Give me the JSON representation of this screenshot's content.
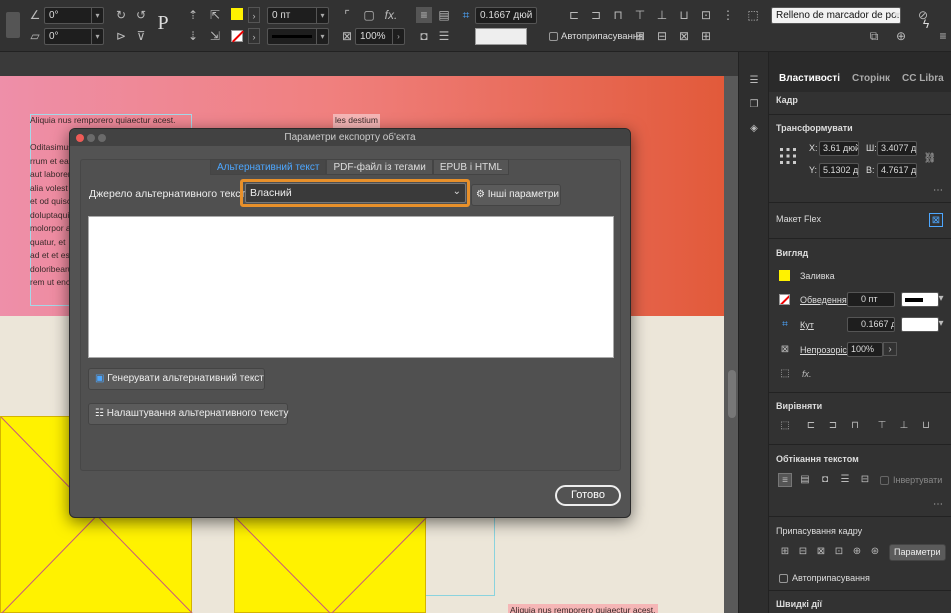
{
  "topbar": {
    "angle1": "0°",
    "angle2": "0°",
    "stroke_weight": "0 пт",
    "zoom": "100%",
    "corner_size": "0.1667 дюй",
    "auto_fit_label": "Автоприпасування",
    "style_select": "Relleno de marcador de po...",
    "fx": "fx.",
    "p_glyph": "P"
  },
  "document": {
    "text_lines": [
      "Aliquia nus remporero quiaectur acest.",
      "",
      "Oditasimus",
      "rrum et ea",
      "aut laborer",
      "alia volest",
      "et od quisc",
      "doluptaqui",
      "molorpor a",
      "quatur, et",
      "ad et et est",
      "doloribearu",
      "rem ut enc"
    ],
    "caption": "les destium",
    "bottom_caption": "Aliquia nus remporero quiaectur acest."
  },
  "dialog": {
    "title": "Параметри експорту об'єкта",
    "tabs": [
      {
        "label": "Альтернативний текст",
        "active": true
      },
      {
        "label": "PDF-файл із тегами",
        "active": false
      },
      {
        "label": "EPUB і HTML",
        "active": false
      }
    ],
    "source_label": "Джерело альтернативного тексту:",
    "source_value": "Власний",
    "more_options": "Інші параметри",
    "alt_text_value": "",
    "generate_button": "Генерувати альтернативний текст",
    "settings_button": "Налаштування альтернативного тексту",
    "done_button": "Готово"
  },
  "panel": {
    "tabs": [
      {
        "label": "Властивості",
        "active": true
      },
      {
        "label": "Сторінк",
        "active": false
      },
      {
        "label": "CC Libra",
        "active": false
      }
    ],
    "frame": "Кадр",
    "transform": "Трансформувати",
    "x_label": "X:",
    "x_value": "3.61 дюй",
    "y_label": "Y:",
    "y_value": "5.1302 дн",
    "w_label": "Ш:",
    "w_value": "3.4077 ді",
    "h_label": "В:",
    "h_value": "4.7617 ді",
    "flex_layout": "Макет Flex",
    "appearance": "Вигляд",
    "fill": "Заливка",
    "stroke": "Обведення",
    "stroke_value": "0 пт",
    "corner": "Кут",
    "corner_value": "0.1667 д",
    "opacity": "Непрозорість",
    "opacity_value": "100%",
    "fx": "fx.",
    "align": "Вирівняти",
    "text_wrap": "Обтікання текстом",
    "invert": "Інвертувати",
    "frame_fitting": "Припасування кадру",
    "fitting_params": "Параметри",
    "auto_fit": "Автоприпасування",
    "quick_actions": "Швидкі дії"
  },
  "colors": {
    "accent": "#4da7ff",
    "highlight": "#e8902a",
    "fill": "#fff200"
  }
}
